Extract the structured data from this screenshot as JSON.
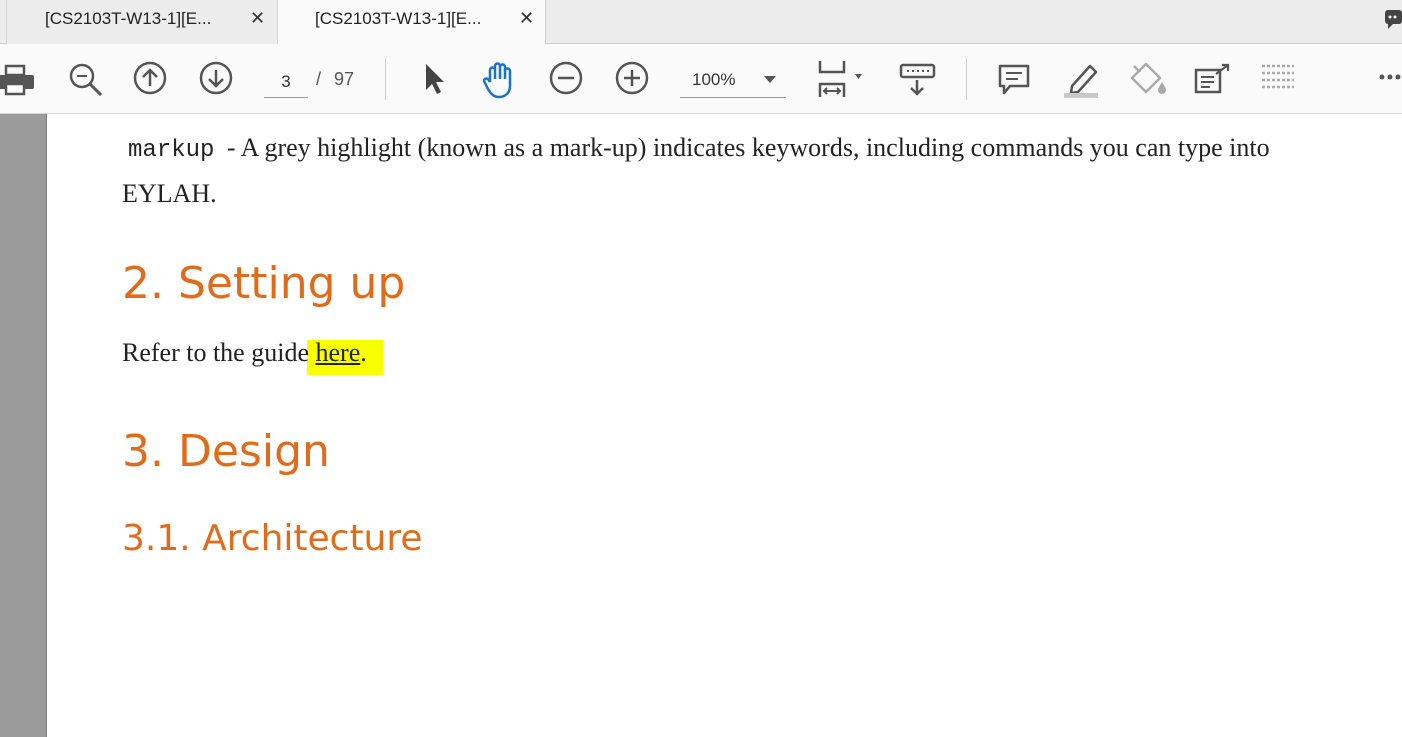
{
  "tabs": [
    {
      "title": "[CS2103T-W13-1][E...",
      "close": "✕"
    },
    {
      "title": "[CS2103T-W13-1][E...",
      "close": "✕"
    }
  ],
  "toolbar": {
    "page_current": "3",
    "page_separator": "/",
    "page_total": "97",
    "zoom": "100%",
    "icons": [
      "print-icon",
      "search-zoom-icon",
      "page-up-icon",
      "page-down-icon",
      "select-arrow-icon",
      "hand-icon",
      "zoom-out-icon",
      "zoom-in-icon",
      "fit-page-icon",
      "scroll-mode-icon",
      "comment-icon",
      "highlight-pen-icon",
      "fill-sign-icon",
      "share-export-icon",
      "more-tools-icon",
      "overflow-menu-icon"
    ],
    "accent_color": "#1a73c9"
  },
  "document": {
    "markup_code": "markup",
    "markup_desc": " - A grey highlight (known as a mark-up) indicates keywords, including commands you can type into EYLAH.",
    "heading_setting_up": "2. Setting up",
    "refer_prefix": "Refer to the guid",
    "refer_e": "e",
    "refer_link": "here",
    "refer_suffix": ".",
    "heading_design": "3. Design",
    "heading_architecture": "3.1. Architecture",
    "heading_color": "#e06c1b",
    "highlight_color": "#f7ff00"
  }
}
